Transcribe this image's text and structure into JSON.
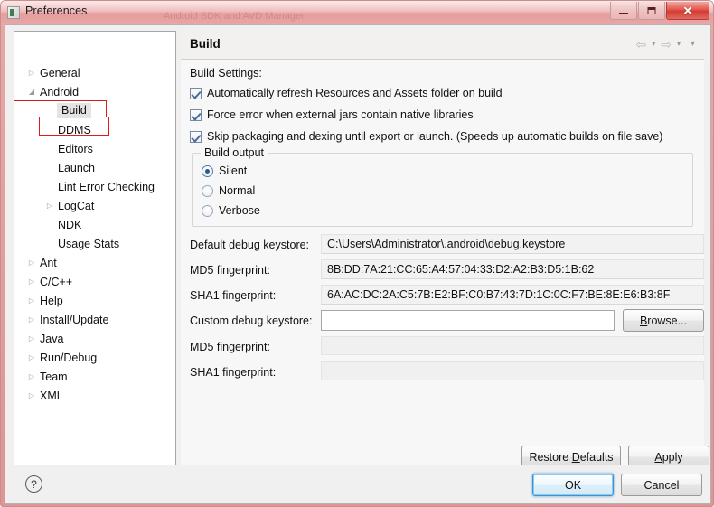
{
  "window": {
    "title": "Preferences",
    "icon": "preferences-window-icon",
    "ghost_text": "Android SDK and AVD Manager",
    "controls": {
      "minimize": "minimize-icon",
      "maximize": "maximize-icon",
      "close": "✕"
    }
  },
  "sidebar": {
    "filter_value": "",
    "filter_placeholder": "",
    "items": [
      {
        "label": "General",
        "level": 0,
        "arrow": "▷",
        "selected": false
      },
      {
        "label": "Android",
        "level": 0,
        "arrow": "◢",
        "selected": false
      },
      {
        "label": "Build",
        "level": 1,
        "arrow": "",
        "selected": true
      },
      {
        "label": "DDMS",
        "level": 1,
        "arrow": "",
        "selected": false
      },
      {
        "label": "Editors",
        "level": 1,
        "arrow": "",
        "selected": false
      },
      {
        "label": "Launch",
        "level": 1,
        "arrow": "",
        "selected": false
      },
      {
        "label": "Lint Error Checking",
        "level": 1,
        "arrow": "",
        "selected": false
      },
      {
        "label": "LogCat",
        "level": 1,
        "arrow": "▷",
        "selected": false
      },
      {
        "label": "NDK",
        "level": 1,
        "arrow": "",
        "selected": false
      },
      {
        "label": "Usage Stats",
        "level": 1,
        "arrow": "",
        "selected": false
      },
      {
        "label": "Ant",
        "level": 0,
        "arrow": "▷",
        "selected": false
      },
      {
        "label": "C/C++",
        "level": 0,
        "arrow": "▷",
        "selected": false
      },
      {
        "label": "Help",
        "level": 0,
        "arrow": "▷",
        "selected": false
      },
      {
        "label": "Install/Update",
        "level": 0,
        "arrow": "▷",
        "selected": false
      },
      {
        "label": "Java",
        "level": 0,
        "arrow": "▷",
        "selected": false
      },
      {
        "label": "Run/Debug",
        "level": 0,
        "arrow": "▷",
        "selected": false
      },
      {
        "label": "Team",
        "level": 0,
        "arrow": "▷",
        "selected": false
      },
      {
        "label": "XML",
        "level": 0,
        "arrow": "▷",
        "selected": false
      }
    ],
    "annotation_color": "#e01b1b"
  },
  "content": {
    "title": "Build",
    "nav": {
      "back": "⇦",
      "back_menu": "▾",
      "forward": "⇨",
      "forward_menu": "▾",
      "view_menu": "▾"
    },
    "settings_label": "Build Settings:",
    "checkboxes": [
      {
        "label": "Automatically refresh Resources and Assets folder on build",
        "checked": true
      },
      {
        "label": "Force error when external jars contain native libraries",
        "checked": true
      },
      {
        "label": "Skip packaging and dexing until export or launch. (Speeds up automatic builds on file save)",
        "checked": true
      }
    ],
    "build_output": {
      "legend": "Build output",
      "options": [
        {
          "label": "Silent",
          "selected": true
        },
        {
          "label": "Normal",
          "selected": false
        },
        {
          "label": "Verbose",
          "selected": false
        }
      ]
    },
    "fields": [
      {
        "label": "Default debug keystore:",
        "value": "C:\\Users\\Administrator\\.android\\debug.keystore",
        "kind": "readonly"
      },
      {
        "label": "MD5 fingerprint:",
        "value": "8B:DD:7A:21:CC:65:A4:57:04:33:D2:A2:B3:D5:1B:62",
        "kind": "readonly"
      },
      {
        "label": "SHA1 fingerprint:",
        "value": "6A:AC:DC:2A:C5:7B:E2:BF:C0:B7:43:7D:1C:0C:F7:BE:8E:E6:B3:8F",
        "kind": "readonly"
      },
      {
        "label": "Custom debug keystore:",
        "value": "",
        "kind": "input"
      },
      {
        "label": "MD5 fingerprint:",
        "value": "",
        "kind": "disabled"
      },
      {
        "label": "SHA1 fingerprint:",
        "value": "",
        "kind": "disabled"
      }
    ],
    "browse_button": {
      "pre": "B",
      "mnemonic": "",
      "post": "rowse..."
    },
    "restore_button": {
      "pre": "Restore ",
      "mnemonic": "D",
      "post": "efaults"
    },
    "apply_button": {
      "pre": "",
      "mnemonic": "A",
      "post": "pply"
    }
  },
  "footer": {
    "help_icon": "?",
    "ok_label": "OK",
    "cancel_label": "Cancel"
  }
}
